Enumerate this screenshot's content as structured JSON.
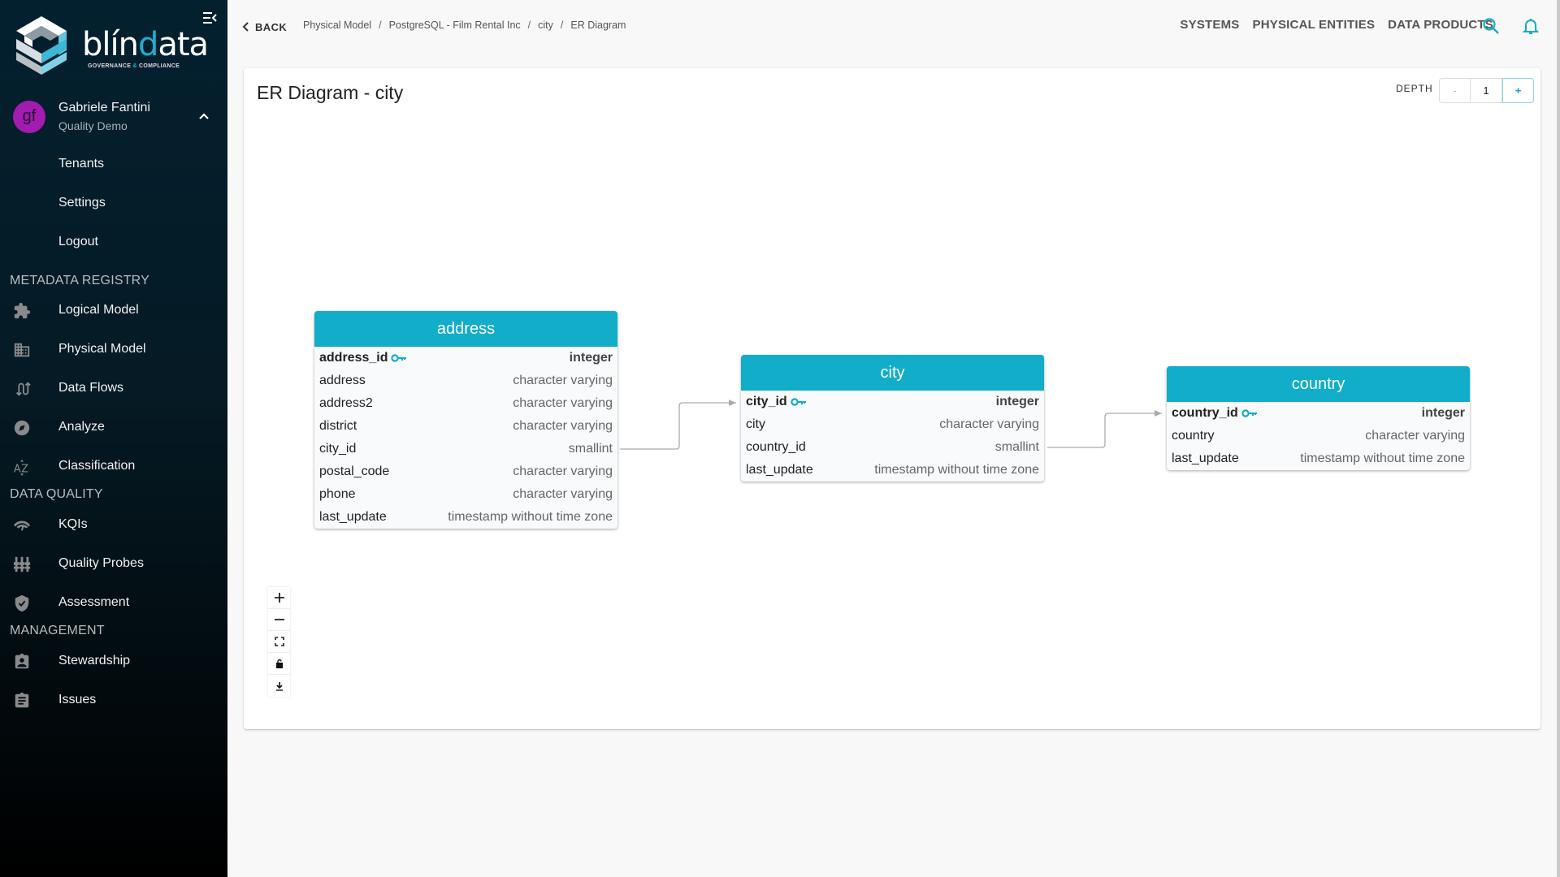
{
  "brand": {
    "name_prefix": "blín",
    "name_accent": "d",
    "name_suffix": "ata",
    "tagline_left": "GOVERNANCE ",
    "tagline_amp": "&",
    "tagline_right": " COMPLIANCE",
    "accent_color": "#12adc8"
  },
  "user": {
    "initials": "gf",
    "name": "Gabriele Fantini",
    "tenant": "Quality Demo",
    "avatar_color": "#a21caf"
  },
  "sidebar": {
    "user_menu": [
      {
        "label": "Tenants"
      },
      {
        "label": "Settings"
      },
      {
        "label": "Logout"
      }
    ],
    "sections": [
      {
        "title": "METADATA REGISTRY",
        "items": [
          {
            "label": "Logical Model",
            "icon": "puzzle-icon"
          },
          {
            "label": "Physical Model",
            "icon": "building-icon"
          },
          {
            "label": "Data Flows",
            "icon": "swap-vertical-icon"
          },
          {
            "label": "Analyze",
            "icon": "compass-icon"
          },
          {
            "label": "Classification",
            "icon": "sort-az-icon"
          }
        ]
      },
      {
        "title": "DATA QUALITY",
        "items": [
          {
            "label": "KQIs",
            "icon": "gauge-icon"
          },
          {
            "label": "Quality Probes",
            "icon": "sliders-icon"
          },
          {
            "label": "Assessment",
            "icon": "shield-check-icon"
          }
        ]
      },
      {
        "title": "MANAGEMENT",
        "items": [
          {
            "label": "Stewardship",
            "icon": "assignment-ind-icon"
          },
          {
            "label": "Issues",
            "icon": "clipboard-icon"
          }
        ]
      }
    ]
  },
  "header": {
    "back_label": "BACK",
    "breadcrumbs": [
      "Physical Model",
      "PostgreSQL - Film Rental Inc",
      "city",
      "ER Diagram"
    ],
    "nav": [
      "SYSTEMS",
      "PHYSICAL ENTITIES",
      "DATA PRODUCTS"
    ]
  },
  "card": {
    "title": "ER Diagram - city",
    "depth_label": "DEPTH",
    "depth_minus": "-",
    "depth_value": "1",
    "depth_plus": "+"
  },
  "entities": [
    {
      "name": "address",
      "attributes": [
        {
          "name": "address_id",
          "type": "integer",
          "pk": true
        },
        {
          "name": "address",
          "type": "character varying",
          "pk": false
        },
        {
          "name": "address2",
          "type": "character varying",
          "pk": false
        },
        {
          "name": "district",
          "type": "character varying",
          "pk": false
        },
        {
          "name": "city_id",
          "type": "smallint",
          "pk": false
        },
        {
          "name": "postal_code",
          "type": "character varying",
          "pk": false
        },
        {
          "name": "phone",
          "type": "character varying",
          "pk": false
        },
        {
          "name": "last_update",
          "type": "timestamp without time zone",
          "pk": false
        }
      ]
    },
    {
      "name": "city",
      "attributes": [
        {
          "name": "city_id",
          "type": "integer",
          "pk": true
        },
        {
          "name": "city",
          "type": "character varying",
          "pk": false
        },
        {
          "name": "country_id",
          "type": "smallint",
          "pk": false
        },
        {
          "name": "last_update",
          "type": "timestamp without time zone",
          "pk": false
        }
      ]
    },
    {
      "name": "country",
      "attributes": [
        {
          "name": "country_id",
          "type": "integer",
          "pk": true
        },
        {
          "name": "country",
          "type": "character varying",
          "pk": false
        },
        {
          "name": "last_update",
          "type": "timestamp without time zone",
          "pk": false
        }
      ]
    }
  ],
  "relationships": [
    {
      "from_entity": "address",
      "from_attr": "city_id",
      "to_entity": "city",
      "to_attr": "city_id"
    },
    {
      "from_entity": "city",
      "from_attr": "country_id",
      "to_entity": "country",
      "to_attr": "country_id"
    }
  ],
  "zoom_controls": [
    "zoom-in",
    "zoom-out",
    "fit-view",
    "lock",
    "download"
  ]
}
